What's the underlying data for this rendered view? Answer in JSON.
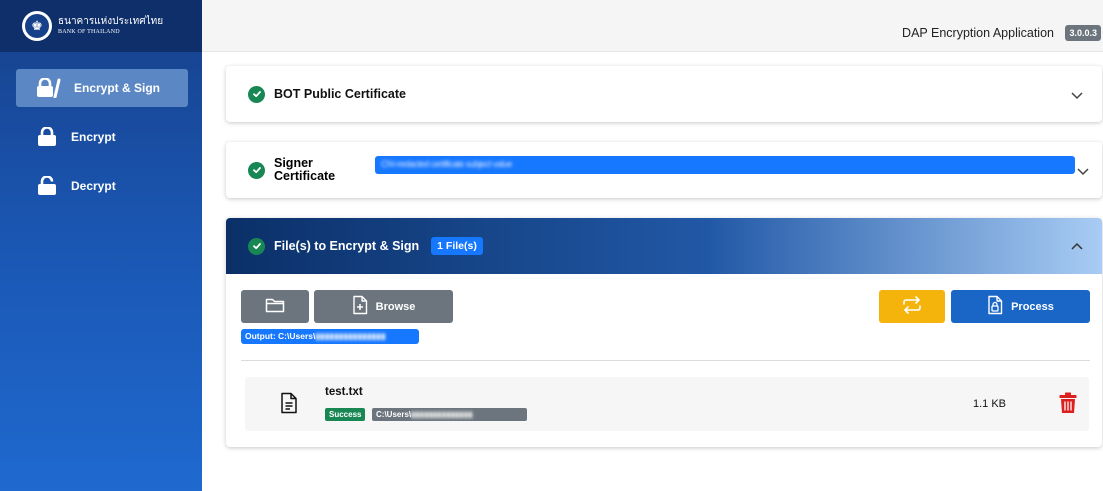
{
  "brand": {
    "thai_name": "ธนาคารแห่งประเทศไทย",
    "english_name": "BANK OF THAILAND",
    "seal_icon": "bot-seal-icon"
  },
  "sidebar": {
    "items": [
      {
        "label": "Encrypt & Sign",
        "icon": "lock-sign-icon",
        "active": true
      },
      {
        "label": "Encrypt",
        "icon": "lock-icon",
        "active": false
      },
      {
        "label": "Decrypt",
        "icon": "unlock-icon",
        "active": false
      }
    ]
  },
  "header": {
    "app_title": "DAP Encryption Application",
    "version": "3.0.0.3"
  },
  "panels": {
    "bot_cert": {
      "title": "BOT Public Certificate",
      "status": "complete",
      "expanded": false
    },
    "signer_cert": {
      "title": "Signer Certificate",
      "value": "CN=redacted certificate subject value",
      "status": "complete",
      "expanded": false
    },
    "files": {
      "title": "File(s) to Encrypt & Sign",
      "count_badge": "1 File(s)",
      "expanded": true,
      "browse_label": "Browse",
      "process_label": "Process",
      "output_label": "Output: C:\\Users\\",
      "list": [
        {
          "name": "test.txt",
          "status": "Success",
          "path": "C:\\Users\\",
          "size": "1.1 KB"
        }
      ]
    }
  },
  "colors": {
    "sidebar": "#1a55b0",
    "success": "#198754",
    "primary": "#1677ff",
    "warning": "#f5b40b",
    "danger": "#dc1f1f",
    "secondary": "#6c757d"
  }
}
